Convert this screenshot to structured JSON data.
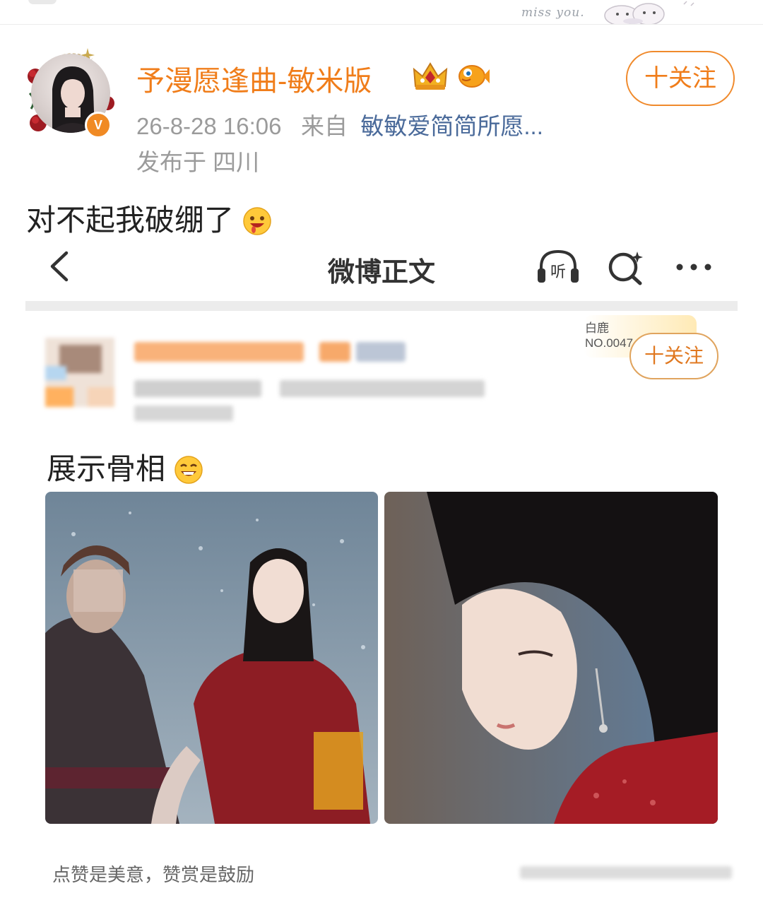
{
  "topbar": {
    "deco_text": "miss you."
  },
  "post": {
    "username": "予漫愿逢曲-敏米版",
    "verified_badge": "V",
    "follow_label": "十关注",
    "timestamp": "26-8-28 16:06",
    "from_prefix": "来自",
    "source": "敏敏爱简简所愿...",
    "location": "发布于 四川",
    "text": "对不起我破绷了"
  },
  "embedded": {
    "nav_title": "微博正文",
    "listen_label": "听",
    "badge_line1": "白鹿",
    "badge_line2": "NO.0047",
    "follow_label": "十关注",
    "text": "展示骨相",
    "footer": "点赞是美意，赞赏是鼓励"
  },
  "colors": {
    "accent": "#f07d1a",
    "link": "#4a6a9a",
    "meta": "#9b9b9b"
  },
  "icons": [
    "crown-icon",
    "fish-icon",
    "back-icon",
    "headphones-icon",
    "search-icon",
    "more-icon",
    "emoji-icon"
  ]
}
